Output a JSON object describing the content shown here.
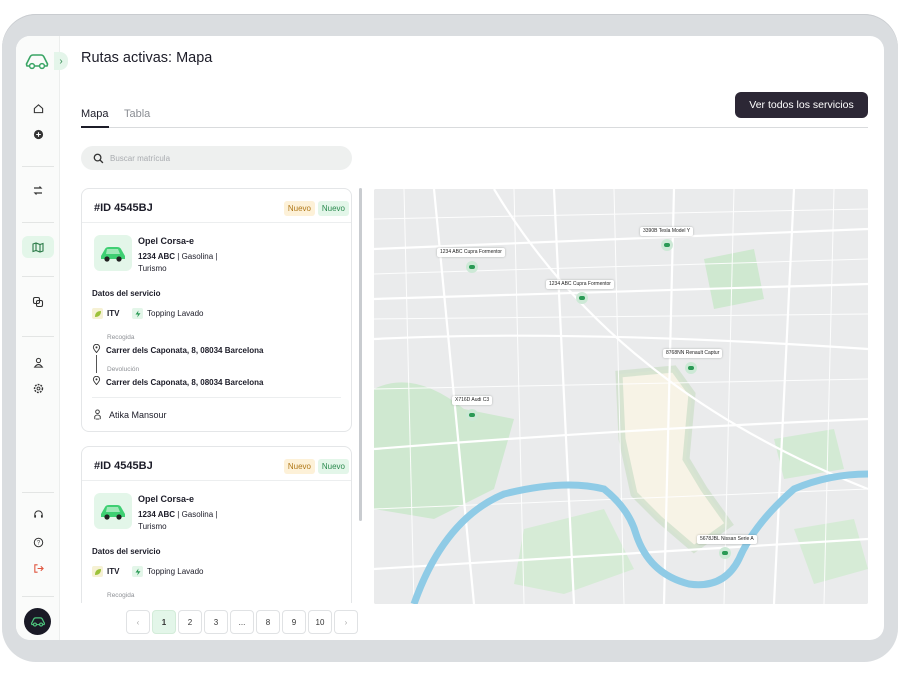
{
  "page": {
    "title": "Rutas activas: Mapa"
  },
  "tabs": [
    {
      "label": "Mapa",
      "active": true
    },
    {
      "label": "Tabla",
      "active": false
    }
  ],
  "cta": {
    "label": "Ver todos los servicios"
  },
  "search": {
    "placeholder": "Buscar matrícula",
    "value": ""
  },
  "sidebar": {
    "items": [
      "home-icon",
      "plus-circle-icon",
      "route-icon",
      "map-icon",
      "layers-icon",
      "user-icon",
      "settings-icon",
      "support-icon",
      "help-icon",
      "logout-icon"
    ],
    "active": "map-icon"
  },
  "cards": [
    {
      "id": "#ID 4545BJ",
      "badges": [
        "Nuevo",
        "Nuevo"
      ],
      "vehicle": {
        "name": "Opel Corsa-e",
        "plate": "1234 ABC",
        "fuel": " | Gasolina |",
        "type": "Turismo"
      },
      "section": "Datos del servicio",
      "services": [
        "ITV",
        "Topping Lavado"
      ],
      "pickup_label": "Recogida",
      "pickup": "Carrer dels Caponata, 8, 08034 Barcelona",
      "return_label": "Devolución",
      "return": "Carrer dels Caponata, 8, 08034 Barcelona",
      "driver": "Atika Mansour"
    },
    {
      "id": "#ID 4545BJ",
      "badges": [
        "Nuevo",
        "Nuevo"
      ],
      "vehicle": {
        "name": "Opel Corsa-e",
        "plate": "1234 ABC",
        "fuel": " | Gasolina |",
        "type": "Turismo"
      },
      "section": "Datos del servicio",
      "services": [
        "ITV",
        "Topping Lavado"
      ],
      "pickup_label": "Recogida"
    }
  ],
  "pagination": {
    "pages": [
      "1",
      "2",
      "3",
      "...",
      "8",
      "9",
      "10"
    ],
    "current": "1",
    "prev": "‹",
    "next": "›"
  },
  "map": {
    "markers": [
      "1234 ABC Cupra Formentor",
      "1234 ABC Cupra Formentor",
      "3390B Tesla Model Y",
      "8768NN Renault Captur",
      "X716D Audi C3",
      "5678JBL Nissan Serie A"
    ]
  },
  "colors": {
    "accent": "#2c2735",
    "brand_green": "#2a9a55",
    "badge_yellow": "#fdf1d8",
    "badge_green": "#e3f6e9",
    "river": "#8fcbe6",
    "park": "#cfe8d0"
  }
}
